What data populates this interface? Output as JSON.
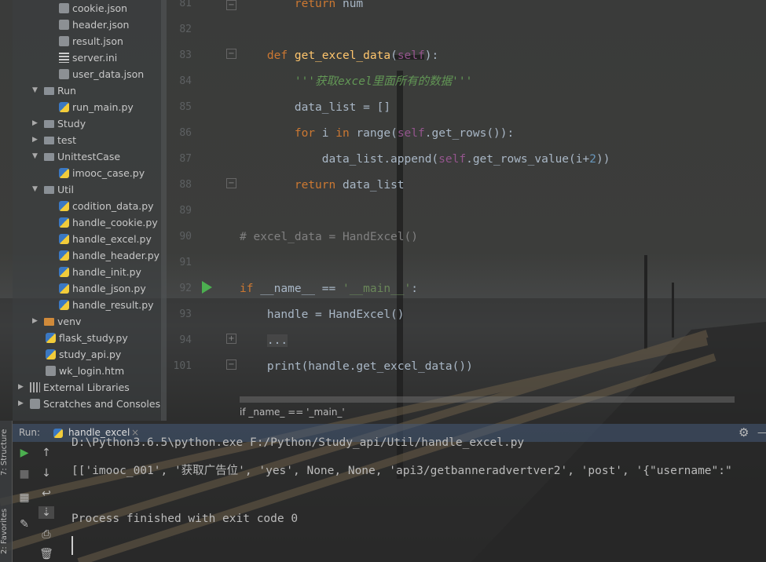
{
  "project_tree": [
    {
      "label": "cookie.json",
      "icon": "json-file-icon",
      "depth": 2
    },
    {
      "label": "header.json",
      "icon": "json-file-icon",
      "depth": 2
    },
    {
      "label": "result.json",
      "icon": "json-file-icon",
      "depth": 2
    },
    {
      "label": "server.ini",
      "icon": "ini-file-icon",
      "depth": 2
    },
    {
      "label": "user_data.json",
      "icon": "json-file-icon",
      "depth": 2
    },
    {
      "label": "Run",
      "icon": "folder-icon",
      "depth": 1,
      "expanded": true
    },
    {
      "label": "run_main.py",
      "icon": "python-file-icon",
      "depth": 2
    },
    {
      "label": "Study",
      "icon": "folder-icon",
      "depth": 1,
      "expanded": false
    },
    {
      "label": "test",
      "icon": "folder-icon",
      "depth": 1,
      "expanded": false
    },
    {
      "label": "UnittestCase",
      "icon": "folder-icon",
      "depth": 1,
      "expanded": true
    },
    {
      "label": "imooc_case.py",
      "icon": "python-file-icon",
      "depth": 2
    },
    {
      "label": "Util",
      "icon": "folder-icon",
      "depth": 1,
      "expanded": true
    },
    {
      "label": "codition_data.py",
      "icon": "python-file-icon",
      "depth": 2
    },
    {
      "label": "handle_cookie.py",
      "icon": "python-file-icon",
      "depth": 2
    },
    {
      "label": "handle_excel.py",
      "icon": "python-file-icon",
      "depth": 2
    },
    {
      "label": "handle_header.py",
      "icon": "python-file-icon",
      "depth": 2
    },
    {
      "label": "handle_init.py",
      "icon": "python-file-icon",
      "depth": 2
    },
    {
      "label": "handle_json.py",
      "icon": "python-file-icon",
      "depth": 2
    },
    {
      "label": "handle_result.py",
      "icon": "python-file-icon",
      "depth": 2
    },
    {
      "label": "venv",
      "icon": "excluded-folder-icon",
      "depth": 1,
      "expanded": false
    },
    {
      "label": "flask_study.py",
      "icon": "python-file-icon",
      "depth": 1.5
    },
    {
      "label": "study_api.py",
      "icon": "python-file-icon",
      "depth": 1.5
    },
    {
      "label": "wk_login.htm",
      "icon": "html-file-icon",
      "depth": 1.5
    },
    {
      "label": "External Libraries",
      "icon": "library-icon",
      "depth": 0,
      "expanded": false
    },
    {
      "label": "Scratches and Consoles",
      "icon": "scratches-icon",
      "depth": 0,
      "expanded": false
    }
  ],
  "editor": {
    "lines": [
      {
        "n": "81",
        "html": "        <span class='kw'>return</span> num"
      },
      {
        "n": "82",
        "html": ""
      },
      {
        "n": "83",
        "html": "    <span class='kw'>def</span> <span style='color:#ffc66d'>get_excel_data</span>(<span class='sf'>self</span>):"
      },
      {
        "n": "84",
        "html": "        <span class='doc'>'''获取excel里面所有的数据'''</span>"
      },
      {
        "n": "85",
        "html": "        data_list = []"
      },
      {
        "n": "86",
        "html": "        <span class='kw'>for</span> i <span class='kw'>in</span> range(<span class='sf'>self</span>.get_rows()):"
      },
      {
        "n": "87",
        "html": "            data_list.append(<span class='sf'>self</span>.get_rows_value(i+<span style='color:#6897bb'>2</span>))"
      },
      {
        "n": "88",
        "html": "        <span class='kw'>return</span> data_list"
      },
      {
        "n": "89",
        "html": ""
      },
      {
        "n": "90",
        "html": "<span class='cm'># excel_data = HandExcel()</span>"
      },
      {
        "n": "91",
        "html": ""
      },
      {
        "n": "92",
        "html": "<span class='kw'>if</span> __name__ == <span style='color:#6a8759'>'__main__'</span>:"
      },
      {
        "n": "93",
        "html": "    handle = HandExcel()"
      },
      {
        "n": "94",
        "html": "    <span style='background:rgba(90,90,90,.4)'>...</span>"
      },
      {
        "n": "101",
        "html": "    print(handle.get_excel_data())"
      }
    ],
    "breadcrumb": "if _name_ == '_main_'"
  },
  "run": {
    "label": "Run:",
    "tab": "handle_excel",
    "console": [
      "D:\\Python3.6.5\\python.exe F:/Python/Study_api/Util/handle_excel.py",
      "[['imooc_001', '获取广告位', 'yes', None, None, 'api3/getbanneradvertver2', 'post', '{\"username\":\"",
      "",
      "Process finished with exit code 0"
    ]
  },
  "side_tabs": {
    "structure": "7: Structure",
    "favorites": "2: Favorites"
  }
}
